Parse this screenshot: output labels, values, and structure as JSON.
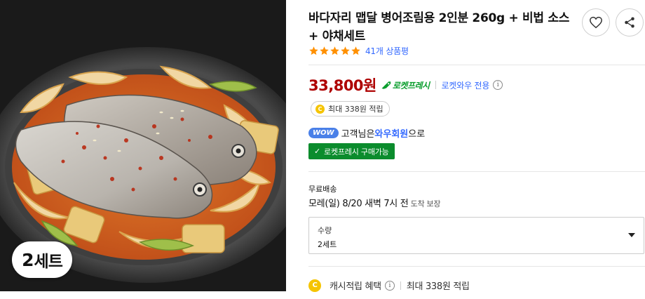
{
  "product": {
    "image_badge": {
      "number": "2",
      "unit": "세트"
    },
    "title": "바다자리 맵달 병어조림용 2인분 260g + 비법 소스 + 야채세트",
    "rating": {
      "stars": 5,
      "review_count": "41개 상품평"
    },
    "price": "33,800원",
    "rocket_fresh_label": "로켓프레시",
    "wow_only_label": "로켓와우 전용",
    "cash_pill": "최대 338원 적립",
    "wow": {
      "badge": "WOW",
      "text_before": "고객님은 ",
      "member": "와우회원",
      "text_after": "으로"
    },
    "rocket_fresh_button": "로켓프레시 구매가능",
    "shipping": {
      "label": "무료배송",
      "date": "모레(일) 8/20 새벽 7시 전",
      "guarantee": " 도착 보장"
    },
    "quantity": {
      "label": "수량",
      "value": "2세트"
    },
    "cash_reward": {
      "coin_label": "C",
      "title": "캐시적립 혜택",
      "amount": "최대 338원 적립"
    }
  },
  "icons": [
    "heart-icon",
    "share-icon",
    "star-icon",
    "rocket-icon",
    "info-icon",
    "coin-icon",
    "check-icon",
    "caret-down-icon"
  ],
  "colors": {
    "price": "#ae0000",
    "link_blue": "#346aff",
    "rocket_green": "#0a9e2d",
    "button_green": "#0b8c2d",
    "star_orange": "#ff9000",
    "coin_yellow": "#f5c400"
  }
}
